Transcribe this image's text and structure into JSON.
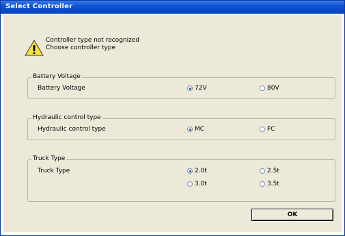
{
  "window": {
    "title": "Select Controller"
  },
  "message": {
    "line1": "Controller type not recognized",
    "line2": "Choose controller type",
    "icon": "warning-icon"
  },
  "groups": [
    {
      "title": "Battery Voltage",
      "row_label": "Battery Voltage",
      "options": [
        {
          "label": "72V",
          "selected": true
        },
        {
          "label": "80V",
          "selected": false
        }
      ]
    },
    {
      "title": "Hydraulic control type",
      "row_label": "Hydraulic control type",
      "options": [
        {
          "label": "MC",
          "selected": true
        },
        {
          "label": "FC",
          "selected": false
        }
      ]
    },
    {
      "title": "Truck Type",
      "row_label": "Truck Type",
      "options": [
        {
          "label": "2.0t",
          "selected": true
        },
        {
          "label": "2.5t",
          "selected": false
        },
        {
          "label": "3.0t",
          "selected": false
        },
        {
          "label": "3.5t",
          "selected": false
        }
      ]
    }
  ],
  "buttons": {
    "ok": "OK"
  },
  "colors": {
    "titlebar": "#0c54d6",
    "dialog_bg": "#ece9d8"
  }
}
